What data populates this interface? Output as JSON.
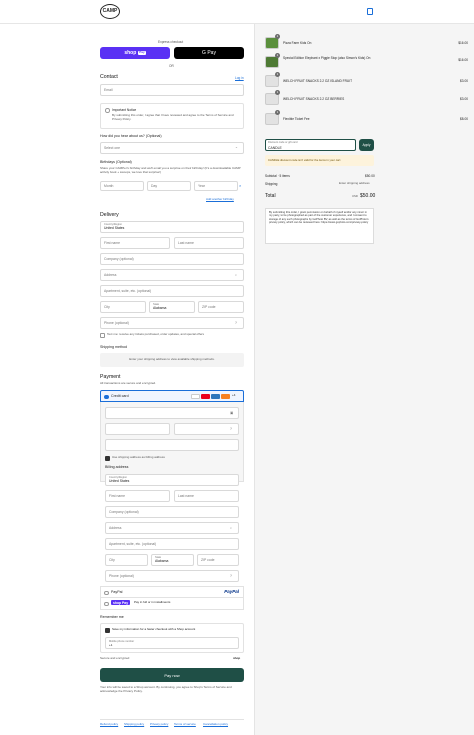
{
  "header": {
    "logo_text": "CAMP",
    "cart_icon": "bag-icon"
  },
  "express": {
    "label": "Express checkout",
    "shop_pay": "shop",
    "shop_pay_tag": "Pay",
    "gpay": "G Pay",
    "or": "OR"
  },
  "contact": {
    "title": "Contact",
    "login": "Log in",
    "email_placeholder": "Email",
    "notice_title": "Important Notice",
    "notice_text": "By submitting this order, I agree that I have reviewed and agree to the Terms of Service and Privacy Policy.",
    "heard_label": "How did you hear about us? (Optional)",
    "heard_value": "Select one",
    "birthday_title": "Birthdays (Optional)",
    "birthday_text": "Share your CAMPer's birthday and we'll email you a surprise on their birthday! (It's a downloadable CAMP activity book + swoops, we love that surprise!)",
    "month": "Month",
    "day": "Day",
    "year": "Year",
    "add_another": "Add another birthday"
  },
  "delivery": {
    "title": "Delivery",
    "country_label": "Country/Region",
    "country": "United States",
    "first_name": "First name",
    "last_name": "Last name",
    "company": "Company (optional)",
    "address": "Address",
    "apartment": "Apartment, suite, etc. (optional)",
    "city": "City",
    "state_label": "State",
    "state": "Alabama",
    "zip": "ZIP code",
    "phone": "Phone (optional)",
    "text_offers": "Text me: receive any tickets purchased, order updates, and special offers",
    "shipping_title": "Shipping method",
    "shipping_note": "Enter your shipping address to view available shipping methods."
  },
  "payment": {
    "title": "Payment",
    "secure": "All transactions are secure and encrypted.",
    "credit_card": "Credit card",
    "card_brands": [
      "VISA",
      "MC",
      "AMEX",
      "DISC"
    ],
    "more_brands": "+4",
    "card_number": "",
    "expiration": "",
    "security": "",
    "name_on_card": "",
    "use_shipping": "Use shipping address as billing address",
    "billing_title": "Billing address",
    "country_label": "Country/Region",
    "country": "United States",
    "first_name": "First name",
    "last_name": "Last name",
    "company": "Company (optional)",
    "address": "Address",
    "apartment": "Apartment, suite, etc. (optional)",
    "city": "City",
    "state_label": "State",
    "state": "Alabama",
    "zip": "ZIP code",
    "phone": "Phone (optional)",
    "paypal": "PayPal",
    "paypal_logo": "PayPal",
    "shoppay": "shop Pay",
    "shoppay_text": "Pay in full or in installments"
  },
  "remember": {
    "title": "Remember me",
    "save_info": "Save my information for a faster checkout with a Shop account",
    "mobile_label": "Mobile phone number",
    "mobile_prefix": "+1",
    "secure": "Secure and encrypted",
    "shop_tag": "shop"
  },
  "pay_now": "Pay now",
  "legal": "Your info will be saved to a Shop account. By continuing, you agree to Shop's Terms of Service and acknowledge the Privacy Policy.",
  "footer_links": [
    "Refund policy",
    "Shipping policy",
    "Privacy policy",
    "Terms of service",
    "Cancellation policy"
  ],
  "cart": {
    "items": [
      {
        "qty": "1",
        "name": "Pizza Farm Kids On",
        "price": "$16.00",
        "color": "#5a8f3c"
      },
      {
        "qty": "1",
        "name": "Special Edition Elephant x Piggie Stop (also Simon's Kids) On",
        "price": "$16.00",
        "color": "#4e7a34"
      },
      {
        "qty": "1",
        "name": "WELCH FRUIT SNACKS 2.2 OZ ISLAND FRUIT",
        "price": "$3.00",
        "color": "#e2e2e2"
      },
      {
        "qty": "1",
        "name": "WELCH FRUIT SNACKS 2.2 OZ BERRIES",
        "price": "$3.00",
        "color": "#e2e2e2"
      },
      {
        "qty": "1",
        "name": "Flexible Ticket Fee",
        "price": "$8.00",
        "color": "#e2e2e2"
      }
    ],
    "discount_label": "Discount code or gift card",
    "discount_value": "CANDLE",
    "apply": "Apply",
    "discount_error": "CANDLE discount code isn't valid for the items in your cart",
    "subtotal_label": "Subtotal · 5 items",
    "subtotal": "$50.00",
    "shipping_label": "Shipping",
    "shipping": "Enter shipping address",
    "total_label": "Total",
    "currency": "USD",
    "total": "$50.00",
    "photo_notice": "By submitting this order, I grant permission on behalf of myself and/or any minor in my party, to be photographed as part of the customer experience, and I consent to storage of any such photographs by GoPhoto BV, as well as the terms of GoPhoto's privacy policy, which can be reviewed here: https://www.gophoto.com/privacy-policy"
  }
}
